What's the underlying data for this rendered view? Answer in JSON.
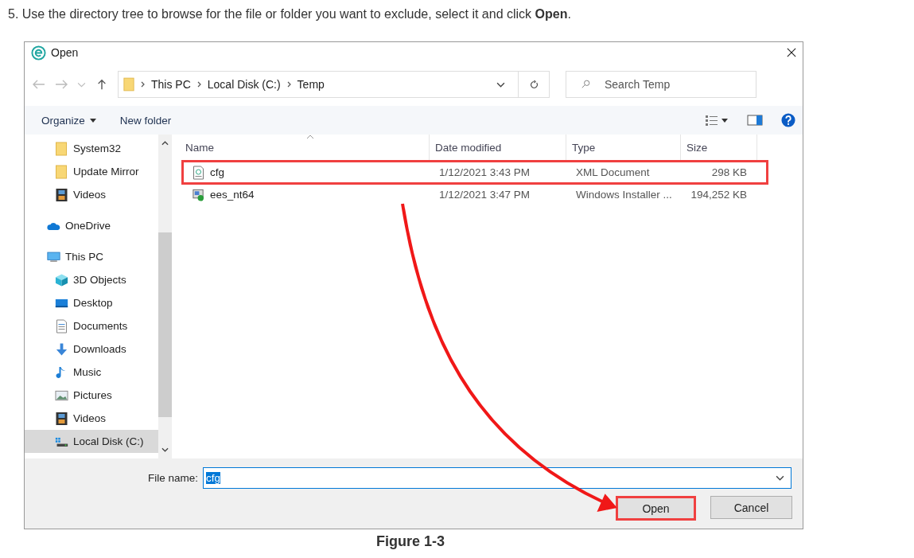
{
  "instruction": "5. Use the directory tree to browse for the file or folder you want to exclude, select it and click **Open**.",
  "dialog": {
    "title": "Open",
    "breadcrumb": [
      "This PC",
      "Local Disk (C:)",
      "Temp"
    ],
    "search": {
      "placeholder": "Search Temp"
    },
    "toolbar": [
      "Organize",
      "New folder"
    ],
    "sidebar": {
      "scrolled_children": [
        {
          "label": "System32",
          "selected": false
        },
        {
          "label": "Update Mirror",
          "selected": false
        },
        {
          "label": "Videos",
          "selected": false
        }
      ],
      "items": [
        {
          "label": "OneDrive",
          "selected": false
        },
        {
          "label": "This PC",
          "selected": false,
          "children": [
            {
              "label": "3D Objects",
              "selected": false
            },
            {
              "label": "Desktop",
              "selected": false
            },
            {
              "label": "Documents",
              "selected": false
            },
            {
              "label": "Downloads",
              "selected": false
            },
            {
              "label": "Music",
              "selected": false
            },
            {
              "label": "Pictures",
              "selected": false
            },
            {
              "label": "Videos",
              "selected": false
            },
            {
              "label": "Local Disk (C:)",
              "selected": true
            }
          ]
        }
      ]
    },
    "columns": [
      "Name",
      "Date modified",
      "Type",
      "Size"
    ],
    "rows": [
      {
        "kind": "xml",
        "name": "cfg",
        "date": "1/12/2021 3:43 PM",
        "type": "XML Document",
        "size": "298 KB",
        "annotated": true
      },
      {
        "kind": "installer",
        "name": "ees_nt64",
        "date": "1/12/2021 3:47 PM",
        "type": "Windows Installer ...",
        "size": "194,252 KB",
        "annotated": false
      }
    ],
    "file_name_label": "File name:",
    "file_name": "cfg",
    "buttons": [
      {
        "label": "Open",
        "annotated": true
      },
      {
        "label": "Cancel",
        "annotated": false
      }
    ]
  },
  "caption": "Figure 1-3"
}
